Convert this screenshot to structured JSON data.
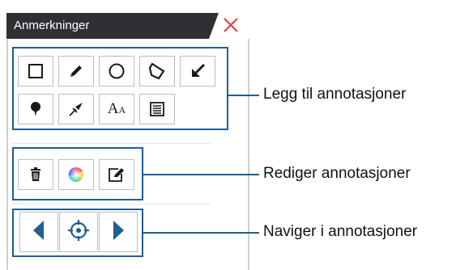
{
  "panel": {
    "title": "Anmerkninger",
    "close_icon": "close-icon"
  },
  "groups": {
    "add": {
      "label": "Legg til annotasjoner",
      "tools": [
        {
          "name": "rectangle-tool",
          "icon": "rectangle-icon"
        },
        {
          "name": "pencil-tool",
          "icon": "pencil-icon"
        },
        {
          "name": "circle-tool",
          "icon": "circle-icon"
        },
        {
          "name": "polygon-tool",
          "icon": "polygon-icon"
        },
        {
          "name": "arrow-tool",
          "icon": "arrow-icon"
        },
        {
          "name": "pin-tool",
          "icon": "pin-icon"
        },
        {
          "name": "measure-tool",
          "icon": "measure-icon"
        },
        {
          "name": "text-tool",
          "icon": "text-icon",
          "text": "AA"
        },
        {
          "name": "note-tool",
          "icon": "note-icon"
        }
      ]
    },
    "edit": {
      "label": "Rediger annotasjoner",
      "tools": [
        {
          "name": "delete-tool",
          "icon": "trash-icon"
        },
        {
          "name": "color-tool",
          "icon": "color-wheel-icon"
        },
        {
          "name": "edit-tool",
          "icon": "edit-icon"
        }
      ]
    },
    "navigate": {
      "label": "Naviger i annotasjoner",
      "tools": [
        {
          "name": "previous-button",
          "icon": "triangle-left-icon"
        },
        {
          "name": "locate-button",
          "icon": "crosshair-icon"
        },
        {
          "name": "next-button",
          "icon": "triangle-right-icon"
        }
      ]
    }
  },
  "colors": {
    "accent": "#1f5d95",
    "titlebar": "#2f3033",
    "close": "#e0393e"
  }
}
